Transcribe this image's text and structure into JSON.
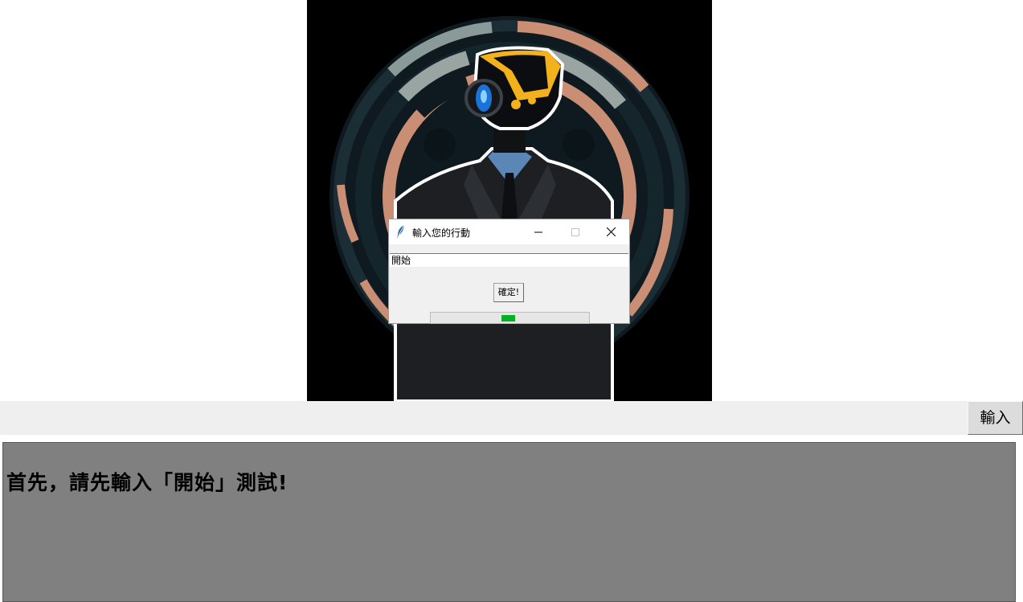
{
  "dialog": {
    "title": "輸入您的行動",
    "icon": "feather-icon",
    "entry_value": "開始",
    "confirm_label": "確定!",
    "progress_indeterminate": true
  },
  "main": {
    "input_button_label": "輸入",
    "message": "首先，請先輸入「開始」測試!"
  },
  "colors": {
    "hero_background": "#000000",
    "message_background": "#808080",
    "progress_fill": "#06b025"
  }
}
